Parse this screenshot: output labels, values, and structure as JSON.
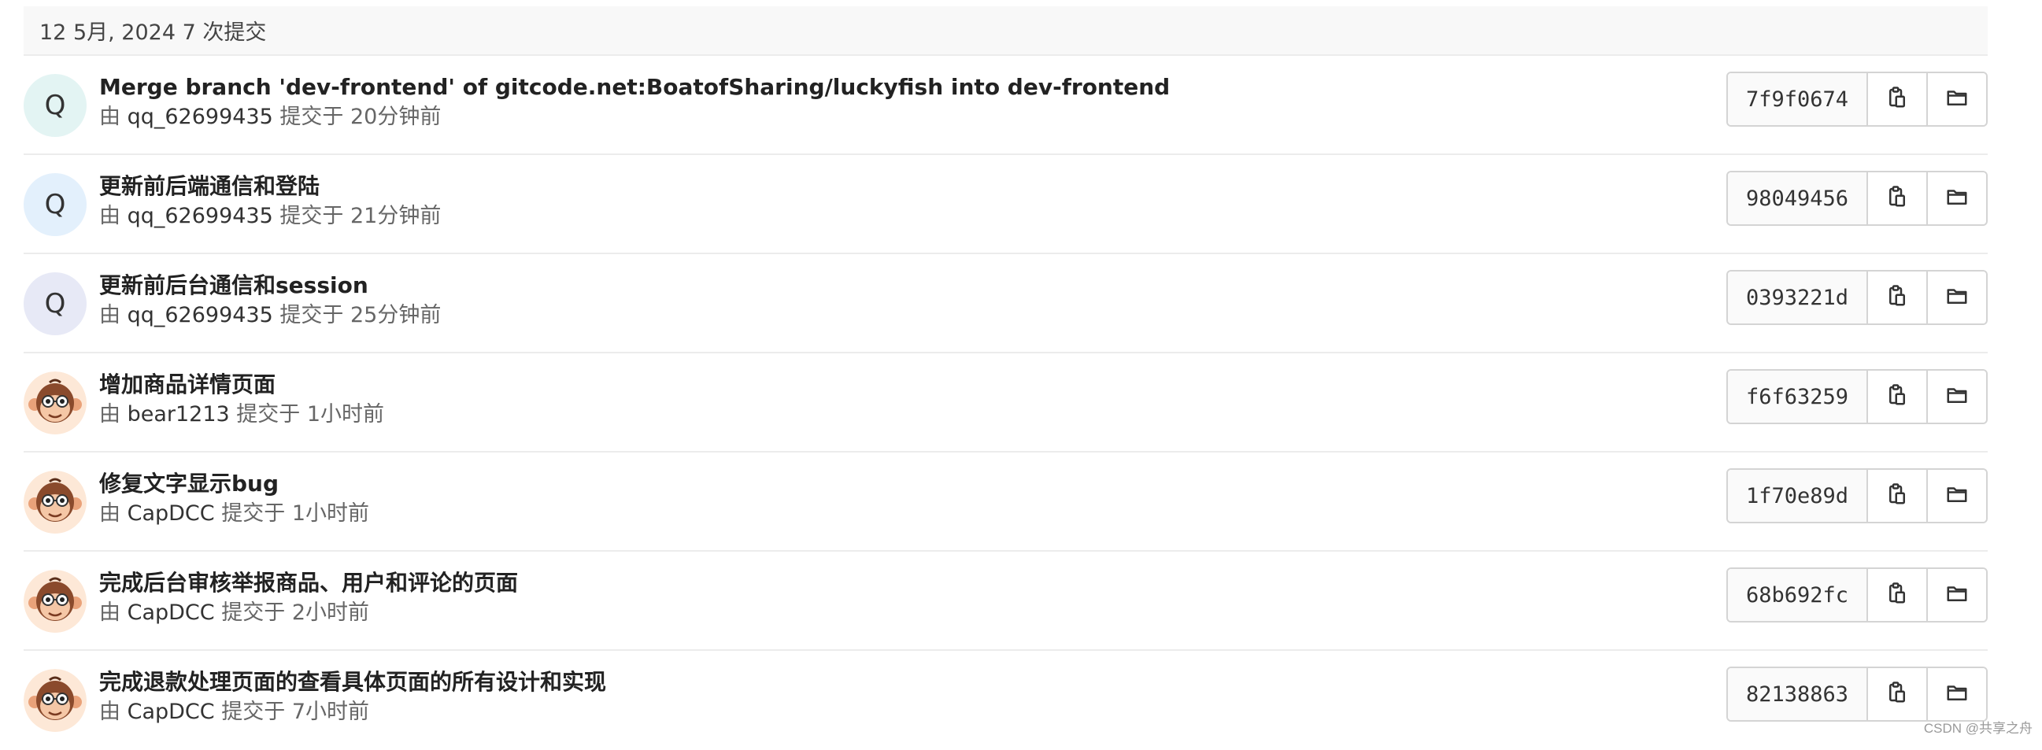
{
  "group": {
    "date_label": "12 5月, 2024 7 次提交"
  },
  "colors": {
    "avatar_q1": "#e3f4f3",
    "avatar_q2": "#e3f0fc",
    "avatar_q3": "#e7e9f6",
    "monkey_bg": "#fde8d7"
  },
  "commits": [
    {
      "avatar_type": "letter",
      "avatar_letter": "Q",
      "avatar_bg": "#e3f4f3",
      "title": "Merge branch 'dev-frontend' of gitcode.net:BoatofSharing/luckyfish into dev-frontend",
      "by": "由",
      "author": "qq_62699435",
      "time": "提交于 20分钟前",
      "sha": "7f9f0674",
      "copy_icon": "clipboard-icon",
      "browse_icon": "folder-icon"
    },
    {
      "avatar_type": "letter",
      "avatar_letter": "Q",
      "avatar_bg": "#e3f0fc",
      "title": "更新前后端通信和登陆",
      "by": "由",
      "author": "qq_62699435",
      "time": "提交于 21分钟前",
      "sha": "98049456",
      "copy_icon": "clipboard-icon",
      "browse_icon": "folder-icon"
    },
    {
      "avatar_type": "letter",
      "avatar_letter": "Q",
      "avatar_bg": "#e7e9f6",
      "title": "更新前后台通信和session",
      "by": "由",
      "author": "qq_62699435",
      "time": "提交于 25分钟前",
      "sha": "0393221d",
      "copy_icon": "clipboard-icon",
      "browse_icon": "folder-icon"
    },
    {
      "avatar_type": "monkey",
      "avatar_icon": "monkey-icon",
      "title": "增加商品详情页面",
      "by": "由",
      "author": "bear1213",
      "time": "提交于 1小时前",
      "sha": "f6f63259",
      "copy_icon": "clipboard-icon",
      "browse_icon": "folder-icon"
    },
    {
      "avatar_type": "monkey",
      "avatar_icon": "monkey-icon",
      "title": "修复文字显示bug",
      "by": "由",
      "author": "CapDCC",
      "time": "提交于 1小时前",
      "sha": "1f70e89d",
      "copy_icon": "clipboard-icon",
      "browse_icon": "folder-icon"
    },
    {
      "avatar_type": "monkey",
      "avatar_icon": "monkey-icon",
      "title": "完成后台审核举报商品、用户和评论的页面",
      "by": "由",
      "author": "CapDCC",
      "time": "提交于 2小时前",
      "sha": "68b692fc",
      "copy_icon": "clipboard-icon",
      "browse_icon": "folder-icon"
    },
    {
      "avatar_type": "monkey",
      "avatar_icon": "monkey-icon",
      "title": "完成退款处理页面的查看具体页面的所有设计和实现",
      "by": "由",
      "author": "CapDCC",
      "time": "提交于 7小时前",
      "sha": "82138863",
      "copy_icon": "clipboard-icon",
      "browse_icon": "folder-icon"
    }
  ],
  "watermark": "CSDN @共享之舟"
}
